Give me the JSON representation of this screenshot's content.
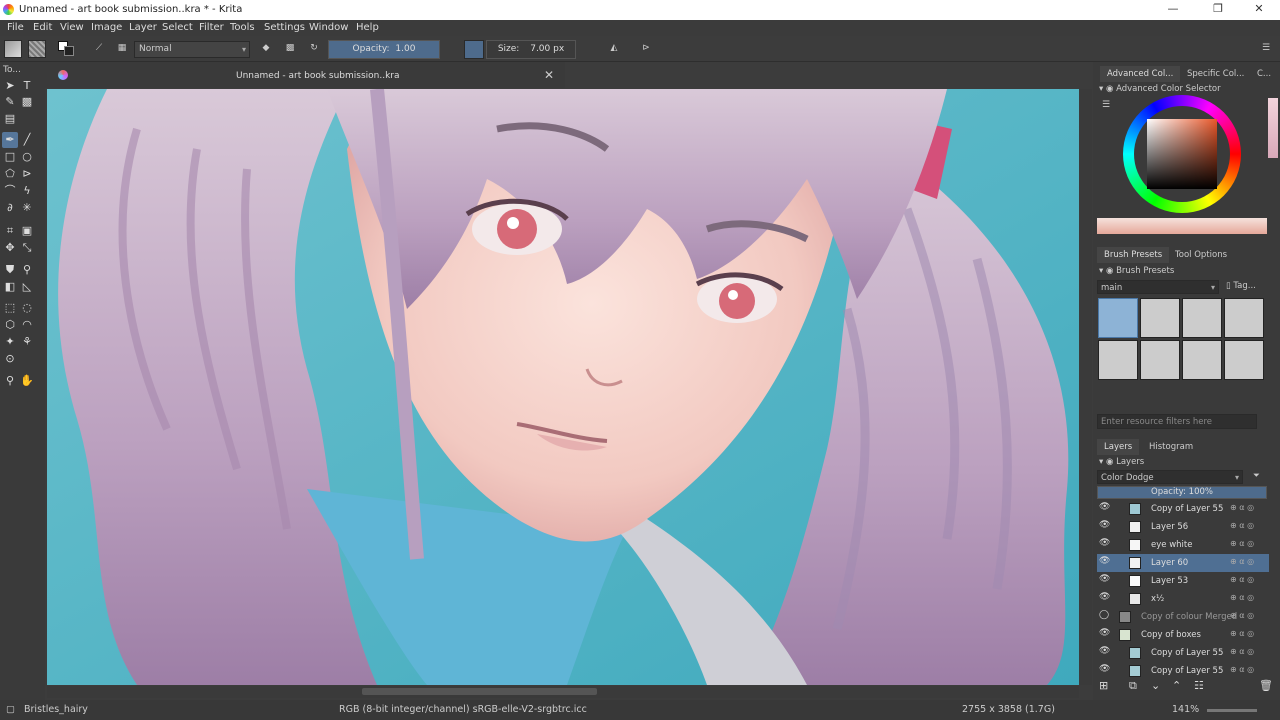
{
  "window": {
    "title": "Unnamed - art book submission..kra * - Krita",
    "controls": {
      "min": "—",
      "max": "❐",
      "close": "✕"
    }
  },
  "menu": [
    "File",
    "Edit",
    "View",
    "Image",
    "Layer",
    "Select",
    "Filter",
    "Tools",
    "Settings",
    "Window",
    "Help"
  ],
  "toolbar": {
    "blend_mode": "Normal",
    "opacity_label": "Opacity:",
    "opacity_value": "1.00",
    "opacity": 1.0,
    "size_label": "Size:",
    "size_value": "7.00 px"
  },
  "toolbox": {
    "header": "To..."
  },
  "document": {
    "tab_title": "Unnamed - art book submission..kra",
    "close": "✕"
  },
  "colors": {
    "accent": "#4f6f93",
    "canvas_bg": "#4fb3c4"
  },
  "dock": {
    "color_tabs": [
      "Advanced Col...",
      "Specific Col...",
      "C..."
    ],
    "color_selector_title": "Advanced Color Selector",
    "brush_tabs": [
      "Brush Presets",
      "Tool Options"
    ],
    "brush_presets_title": "Brush Presets",
    "brush_tag": "main",
    "tag_label": "Tag...",
    "filter_placeholder": "Enter resource filters here",
    "layer_tabs": [
      "Layers",
      "Histogram"
    ],
    "layers_title": "Layers",
    "layer_blend": "Color Dodge",
    "layer_opacity_label": "Opacity:  100%",
    "layer_opacity": 1.0,
    "layers": [
      {
        "name": "Copy of Layer 55",
        "selected": false,
        "dim": false
      },
      {
        "name": "Layer 56",
        "selected": false,
        "dim": false
      },
      {
        "name": "eye white",
        "selected": false,
        "dim": false
      },
      {
        "name": "Layer 60",
        "selected": true,
        "dim": false
      },
      {
        "name": "Layer 53",
        "selected": false,
        "dim": false
      },
      {
        "name": "x½",
        "selected": false,
        "dim": false
      },
      {
        "name": "Copy of colour Merged",
        "selected": false,
        "dim": true
      },
      {
        "name": "Copy of boxes",
        "selected": false,
        "dim": false
      },
      {
        "name": "Copy of Layer 55",
        "selected": false,
        "dim": false
      },
      {
        "name": "Copy of Layer 55",
        "selected": false,
        "dim": false
      }
    ]
  },
  "status": {
    "brush": "Bristles_hairy",
    "color_space": "RGB (8-bit integer/channel)  sRGB-elle-V2-srgbtrc.icc",
    "dimensions": "2755 x 3858 (1.7G)",
    "zoom": "141%"
  }
}
